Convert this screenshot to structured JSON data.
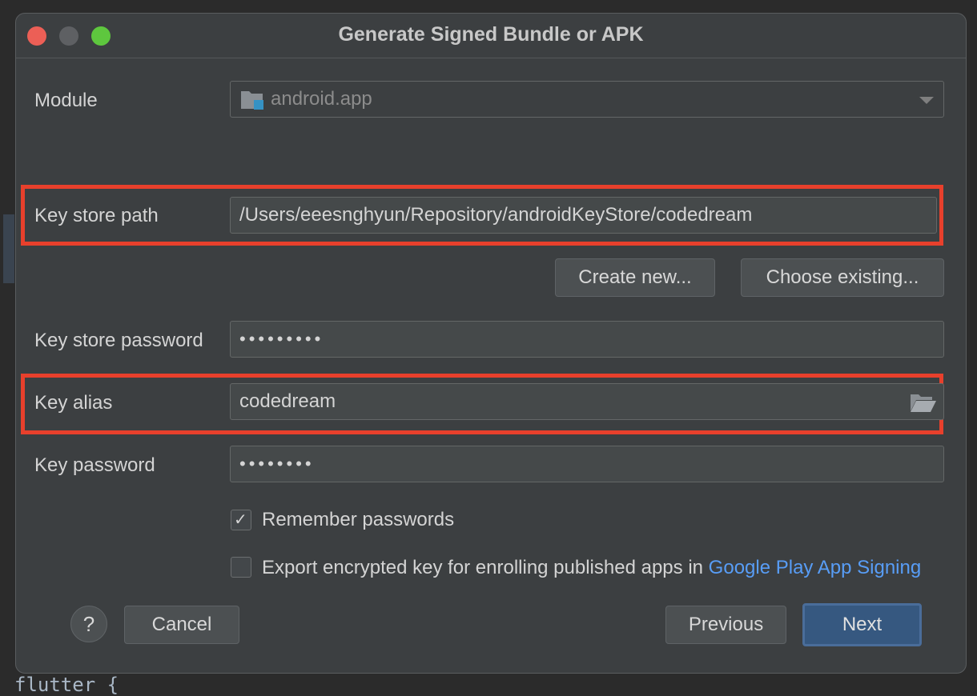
{
  "window": {
    "title": "Generate Signed Bundle or APK"
  },
  "background": {
    "code_fragment": "flutter {"
  },
  "form": {
    "module": {
      "label": "Module",
      "value": "android.app"
    },
    "key_store_path": {
      "label": "Key store path",
      "value": "/Users/eeesnghyun/Repository/androidKeyStore/codedream"
    },
    "create_new_label": "Create new...",
    "choose_existing_label": "Choose existing...",
    "key_store_password": {
      "label": "Key store password",
      "masked": "•••••••••"
    },
    "key_alias": {
      "label": "Key alias",
      "value": "codedream"
    },
    "key_password": {
      "label": "Key password",
      "masked": "••••••••"
    },
    "remember_passwords": {
      "label": "Remember passwords",
      "checked": true
    },
    "export_key": {
      "label_prefix": "Export encrypted key for enrolling published apps in ",
      "link_text": "Google Play App Signing",
      "checked": false
    }
  },
  "footer": {
    "help_label": "?",
    "cancel_label": "Cancel",
    "previous_label": "Previous",
    "next_label": "Next"
  },
  "colors": {
    "highlight": "#e8402c",
    "link": "#589df6",
    "primary_button": "#365880"
  }
}
